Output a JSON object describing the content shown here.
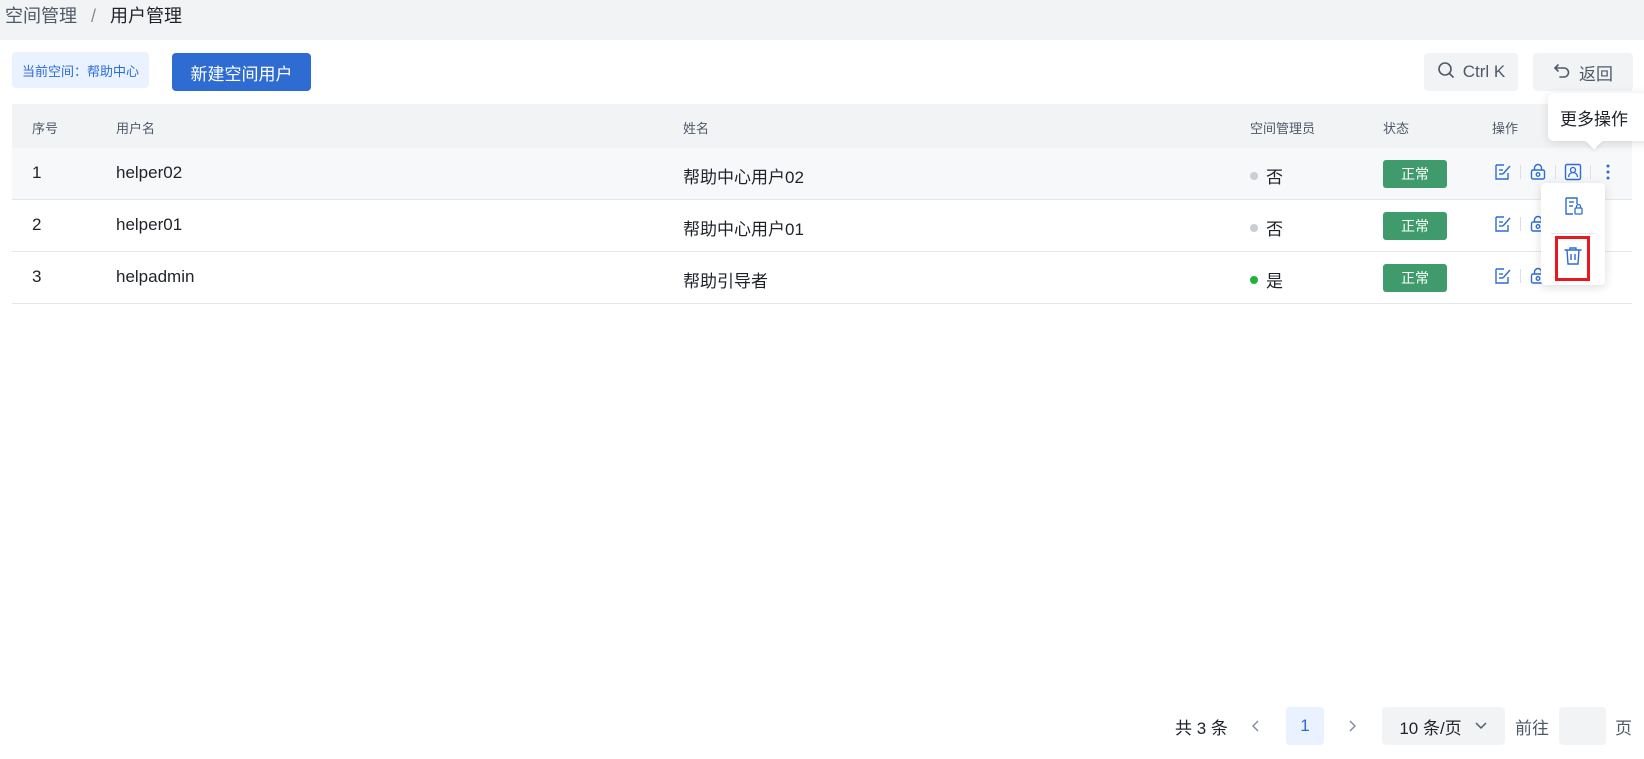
{
  "breadcrumb": {
    "parent": "空间管理",
    "separator": "/",
    "current": "用户管理"
  },
  "toolbar": {
    "space_tag": "当前空间：帮助中心",
    "new_button": "新建空间用户",
    "search_label": "Ctrl K",
    "back_label": "返回"
  },
  "table": {
    "headers": {
      "index": "序号",
      "username": "用户名",
      "name": "姓名",
      "admin": "空间管理员",
      "status": "状态",
      "ops": "操作"
    },
    "rows": [
      {
        "index": "1",
        "username": "helper02",
        "name": "帮助中心用户02",
        "admin": "否",
        "admin_dot": "#c9cdd4",
        "status": "正常"
      },
      {
        "index": "2",
        "username": "helper01",
        "name": "帮助中心用户01",
        "admin": "否",
        "admin_dot": "#c9cdd4",
        "status": "正常"
      },
      {
        "index": "3",
        "username": "helpadmin",
        "name": "帮助引导者",
        "admin": "是",
        "admin_dot": "#1fb33a",
        "status": "正常"
      }
    ]
  },
  "tooltip": {
    "text": "更多操作"
  },
  "pagination": {
    "total": "共 3 条",
    "current_page": "1",
    "page_size": "10 条/页",
    "goto": "前往",
    "page_suffix": "页"
  },
  "colors": {
    "primary": "#2e6cd1",
    "status_ok": "#3f9b6c",
    "highlight": "#e8191c"
  }
}
